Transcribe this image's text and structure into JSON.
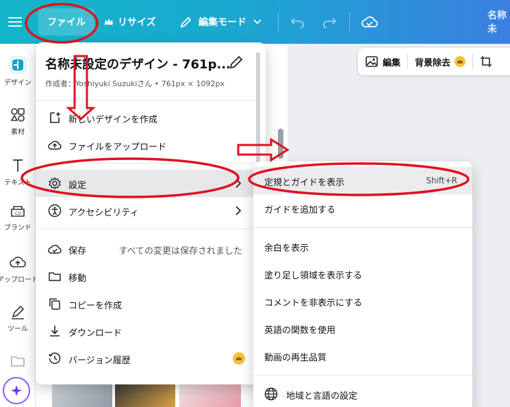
{
  "topbar": {
    "file_label": "ファイル",
    "resize_label": "リサイズ",
    "edit_mode_label": "編集モード",
    "design_name_short": "名称未"
  },
  "rail": {
    "items": [
      {
        "label": "デザイン"
      },
      {
        "label": "素材"
      },
      {
        "label": "テキスト"
      },
      {
        "label": "ブランド"
      },
      {
        "label": "アップロード"
      },
      {
        "label": "ツール"
      }
    ]
  },
  "image_toolbar": {
    "edit_label": "編集",
    "remove_bg_label": "背景除去"
  },
  "file_menu": {
    "title": "名称未設定のデザイン - 761p...",
    "subtitle": "作成者：Yoshiyuki Suzukiさん • 761px × 1092px",
    "items": [
      {
        "label": "新しいデザインを作成"
      },
      {
        "label": "ファイルをアップロード"
      },
      {
        "label": "設定"
      },
      {
        "label": "アクセシビリティ"
      },
      {
        "label": "保存",
        "status": "すべての変更は保存されました"
      },
      {
        "label": "移動"
      },
      {
        "label": "コピーを作成"
      },
      {
        "label": "ダウンロード"
      },
      {
        "label": "バージョン履歴"
      }
    ]
  },
  "settings_submenu": {
    "items": [
      {
        "label": "定規とガイドを表示",
        "shortcut": "Shift+R"
      },
      {
        "label": "ガイドを追加する"
      },
      {
        "label": "余白を表示"
      },
      {
        "label": "塗り足し領域を表示する"
      },
      {
        "label": "コメントを非表示にする"
      },
      {
        "label": "英語の関数を使用"
      },
      {
        "label": "動画の再生品質"
      },
      {
        "label": "地域と言語の設定"
      }
    ]
  },
  "colors": {
    "annotation_red": "#e0101e",
    "crown_gold": "#f3c23b",
    "accent_teal": "#12b5c9"
  }
}
